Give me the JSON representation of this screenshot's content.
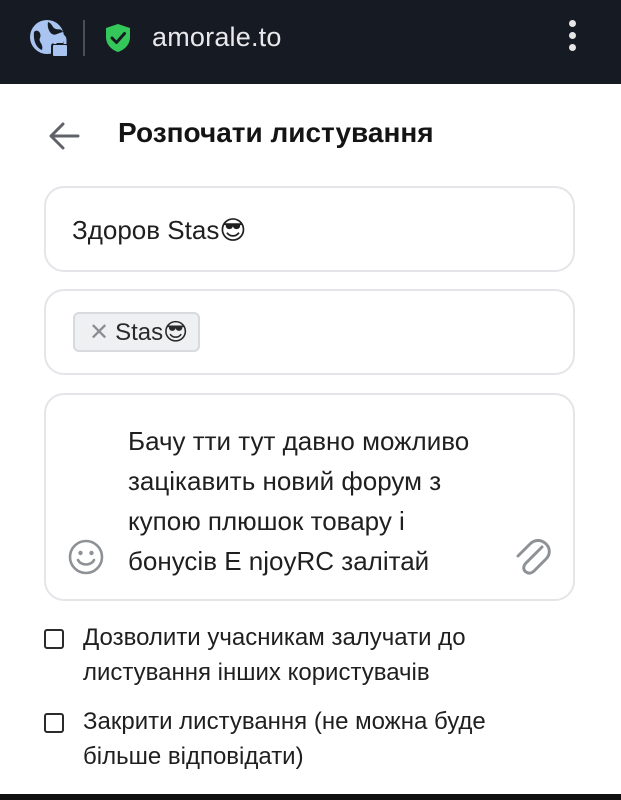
{
  "browser": {
    "url": "amorale.to",
    "icons": {
      "site": "globe-lock-icon",
      "security": "shield-check-icon",
      "menu": "more-vert-icon"
    },
    "colors": {
      "bar_bg": "#161a23",
      "shield": "#34c759"
    }
  },
  "header": {
    "back_icon": "arrow-left-icon",
    "title": "Розпочати листування"
  },
  "form": {
    "title_value": "Здоров Stas😎",
    "recipients": [
      {
        "name": "Stas😎",
        "remove": "✕"
      }
    ],
    "message": "Бачу тти тут давно можливо\nзацікавить новий форум з\nкупою плюшок товару і\nбонусів E njoyRC залітай",
    "message_icons": {
      "emoji": "smiley-icon",
      "attach": "paperclip-icon"
    }
  },
  "options": [
    {
      "label": "Дозволити учасникам залучати до\nлистування інших користувачів",
      "checked": false
    },
    {
      "label": "Закрити листування (не можна буде\nбільше відповідати)",
      "checked": false
    }
  ]
}
